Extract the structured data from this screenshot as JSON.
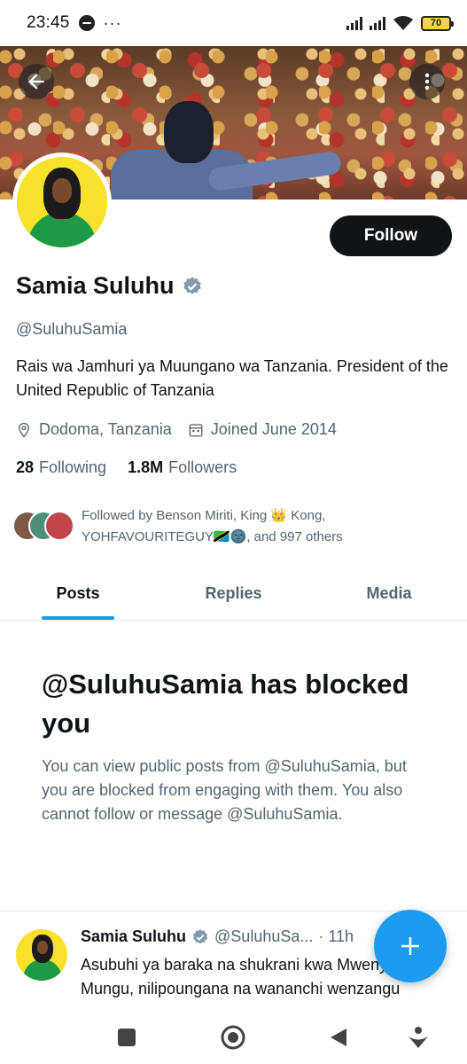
{
  "status_bar": {
    "time": "23:45",
    "battery": "70",
    "more": "···"
  },
  "profile": {
    "follow_label": "Follow",
    "name": "Samia Suluhu",
    "handle": "@SuluhuSamia",
    "bio": "Rais wa Jamhuri ya Muungano wa Tanzania. President of the United Republic of Tanzania",
    "location": "Dodoma, Tanzania",
    "joined": "Joined June 2014",
    "following_count": "28",
    "following_label": "Following",
    "followers_count": "1.8M",
    "followers_label": "Followers",
    "followed_by_line1": "Followed by Benson Miriti, King 👑 Kong,",
    "followed_by_line2": "YOHFAVOURITEGUY🇹🇿🌚, and 997 others"
  },
  "tabs": [
    {
      "label": "Posts",
      "active": true
    },
    {
      "label": "Replies",
      "active": false
    },
    {
      "label": "Media",
      "active": false
    }
  ],
  "blocked": {
    "title": "@SuluhuSamia has blocked you",
    "message": "You can view public posts from @SuluhuSamia, but you are blocked from engaging with them. You also cannot follow or message @SuluhuSamia."
  },
  "post": {
    "name": "Samia Suluhu",
    "handle": "@SuluhuSa...",
    "time": "· 11h",
    "text": "Asubuhi ya baraka na shukrani kwa Mwenyezi Mungu, nilipoungana na wananchi wenzangu"
  },
  "colors": {
    "accent": "#1d9bf0",
    "text_primary": "#0f1419",
    "text_secondary": "#536471",
    "follow_button": "#0f1419",
    "verified_badge": "#829aab"
  },
  "icons": {
    "back": "arrow-left-icon",
    "menu": "more-vertical-icon",
    "location": "location-pin-icon",
    "calendar": "calendar-icon",
    "verified": "verified-badge-icon",
    "compose": "plus-icon"
  }
}
